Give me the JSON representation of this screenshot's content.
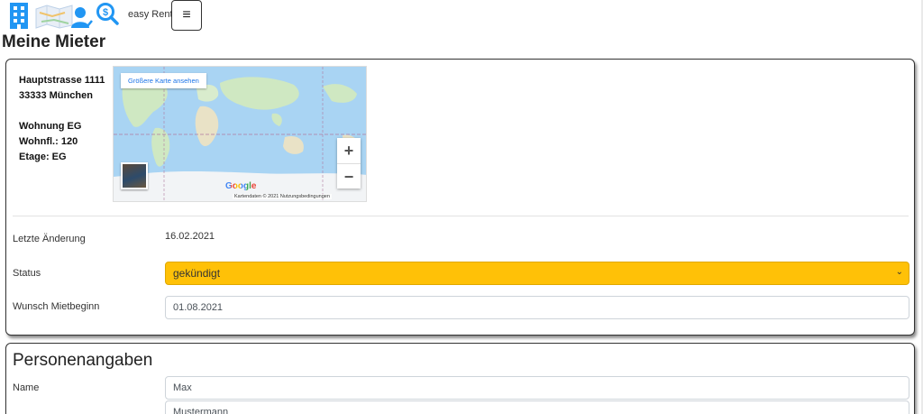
{
  "brand": {
    "name": "easy Rent"
  },
  "header": {
    "menu_glyph": "≡",
    "page_title": "Meine Mieter"
  },
  "icons": [
    "building-icon",
    "map-thumbnail-icon",
    "user-check-icon",
    "dollar-search-icon",
    "hamburger-icon"
  ],
  "property": {
    "street": "Hauptstrasse 1111",
    "city": "33333 München",
    "unit": "Wohnung EG",
    "area": "Wohnfl.: 120",
    "floor": "Etage: EG"
  },
  "map": {
    "larger_map_link": "Größere Karte ansehen",
    "zoom_in": "+",
    "zoom_out": "−",
    "logo": "Google",
    "attribution": "Kartendaten © 2021    Nutzungsbedingungen"
  },
  "details": {
    "last_change_label": "Letzte Änderung",
    "last_change_value": "16.02.2021",
    "status_label": "Status",
    "status_value": "gekündigt",
    "status_chevron": "⌄",
    "start_label": "Wunsch Mietbeginn",
    "start_value": "01.08.2021"
  },
  "person": {
    "section_title": "Personenangaben",
    "name_label": "Name",
    "first_name": "Max",
    "last_name": "Mustermann"
  },
  "colors": {
    "status_bg": "#ffc107",
    "icon_blue": "#2196f3",
    "map_water": "#a9d4f3",
    "map_land": "#cfe8c2"
  }
}
